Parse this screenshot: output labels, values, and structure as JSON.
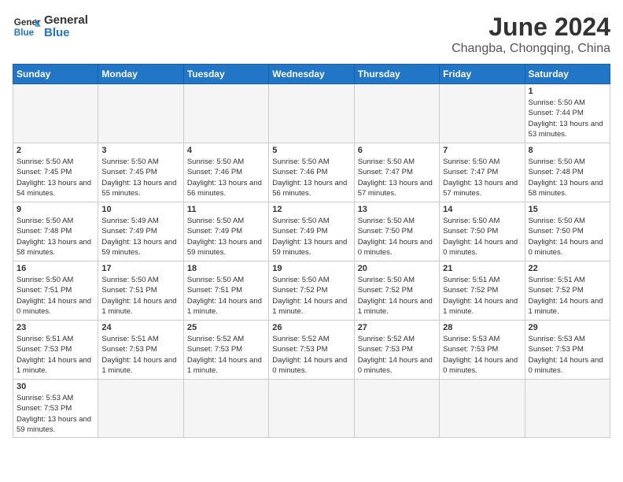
{
  "header": {
    "logo_general": "General",
    "logo_blue": "Blue",
    "title": "June 2024",
    "subtitle": "Changba, Chongqing, China"
  },
  "days_of_week": [
    "Sunday",
    "Monday",
    "Tuesday",
    "Wednesday",
    "Thursday",
    "Friday",
    "Saturday"
  ],
  "weeks": [
    [
      {
        "day": "",
        "info": ""
      },
      {
        "day": "",
        "info": ""
      },
      {
        "day": "",
        "info": ""
      },
      {
        "day": "",
        "info": ""
      },
      {
        "day": "",
        "info": ""
      },
      {
        "day": "",
        "info": ""
      },
      {
        "day": "1",
        "info": "Sunrise: 5:50 AM\nSunset: 7:44 PM\nDaylight: 13 hours and 53 minutes."
      }
    ],
    [
      {
        "day": "2",
        "info": "Sunrise: 5:50 AM\nSunset: 7:45 PM\nDaylight: 13 hours and 54 minutes."
      },
      {
        "day": "3",
        "info": "Sunrise: 5:50 AM\nSunset: 7:45 PM\nDaylight: 13 hours and 55 minutes."
      },
      {
        "day": "4",
        "info": "Sunrise: 5:50 AM\nSunset: 7:46 PM\nDaylight: 13 hours and 56 minutes."
      },
      {
        "day": "5",
        "info": "Sunrise: 5:50 AM\nSunset: 7:46 PM\nDaylight: 13 hours and 56 minutes."
      },
      {
        "day": "6",
        "info": "Sunrise: 5:50 AM\nSunset: 7:47 PM\nDaylight: 13 hours and 57 minutes."
      },
      {
        "day": "7",
        "info": "Sunrise: 5:50 AM\nSunset: 7:47 PM\nDaylight: 13 hours and 57 minutes."
      },
      {
        "day": "8",
        "info": "Sunrise: 5:50 AM\nSunset: 7:48 PM\nDaylight: 13 hours and 58 minutes."
      }
    ],
    [
      {
        "day": "9",
        "info": "Sunrise: 5:50 AM\nSunset: 7:48 PM\nDaylight: 13 hours and 58 minutes."
      },
      {
        "day": "10",
        "info": "Sunrise: 5:49 AM\nSunset: 7:49 PM\nDaylight: 13 hours and 59 minutes."
      },
      {
        "day": "11",
        "info": "Sunrise: 5:50 AM\nSunset: 7:49 PM\nDaylight: 13 hours and 59 minutes."
      },
      {
        "day": "12",
        "info": "Sunrise: 5:50 AM\nSunset: 7:49 PM\nDaylight: 13 hours and 59 minutes."
      },
      {
        "day": "13",
        "info": "Sunrise: 5:50 AM\nSunset: 7:50 PM\nDaylight: 14 hours and 0 minutes."
      },
      {
        "day": "14",
        "info": "Sunrise: 5:50 AM\nSunset: 7:50 PM\nDaylight: 14 hours and 0 minutes."
      },
      {
        "day": "15",
        "info": "Sunrise: 5:50 AM\nSunset: 7:50 PM\nDaylight: 14 hours and 0 minutes."
      }
    ],
    [
      {
        "day": "16",
        "info": "Sunrise: 5:50 AM\nSunset: 7:51 PM\nDaylight: 14 hours and 0 minutes."
      },
      {
        "day": "17",
        "info": "Sunrise: 5:50 AM\nSunset: 7:51 PM\nDaylight: 14 hours and 1 minute."
      },
      {
        "day": "18",
        "info": "Sunrise: 5:50 AM\nSunset: 7:51 PM\nDaylight: 14 hours and 1 minute."
      },
      {
        "day": "19",
        "info": "Sunrise: 5:50 AM\nSunset: 7:52 PM\nDaylight: 14 hours and 1 minute."
      },
      {
        "day": "20",
        "info": "Sunrise: 5:50 AM\nSunset: 7:52 PM\nDaylight: 14 hours and 1 minute."
      },
      {
        "day": "21",
        "info": "Sunrise: 5:51 AM\nSunset: 7:52 PM\nDaylight: 14 hours and 1 minute."
      },
      {
        "day": "22",
        "info": "Sunrise: 5:51 AM\nSunset: 7:52 PM\nDaylight: 14 hours and 1 minute."
      }
    ],
    [
      {
        "day": "23",
        "info": "Sunrise: 5:51 AM\nSunset: 7:53 PM\nDaylight: 14 hours and 1 minute."
      },
      {
        "day": "24",
        "info": "Sunrise: 5:51 AM\nSunset: 7:53 PM\nDaylight: 14 hours and 1 minute."
      },
      {
        "day": "25",
        "info": "Sunrise: 5:52 AM\nSunset: 7:53 PM\nDaylight: 14 hours and 1 minute."
      },
      {
        "day": "26",
        "info": "Sunrise: 5:52 AM\nSunset: 7:53 PM\nDaylight: 14 hours and 0 minutes."
      },
      {
        "day": "27",
        "info": "Sunrise: 5:52 AM\nSunset: 7:53 PM\nDaylight: 14 hours and 0 minutes."
      },
      {
        "day": "28",
        "info": "Sunrise: 5:53 AM\nSunset: 7:53 PM\nDaylight: 14 hours and 0 minutes."
      },
      {
        "day": "29",
        "info": "Sunrise: 5:53 AM\nSunset: 7:53 PM\nDaylight: 14 hours and 0 minutes."
      }
    ],
    [
      {
        "day": "30",
        "info": "Sunrise: 5:53 AM\nSunset: 7:53 PM\nDaylight: 13 hours and 59 minutes."
      },
      {
        "day": "",
        "info": ""
      },
      {
        "day": "",
        "info": ""
      },
      {
        "day": "",
        "info": ""
      },
      {
        "day": "",
        "info": ""
      },
      {
        "day": "",
        "info": ""
      },
      {
        "day": "",
        "info": ""
      }
    ]
  ]
}
